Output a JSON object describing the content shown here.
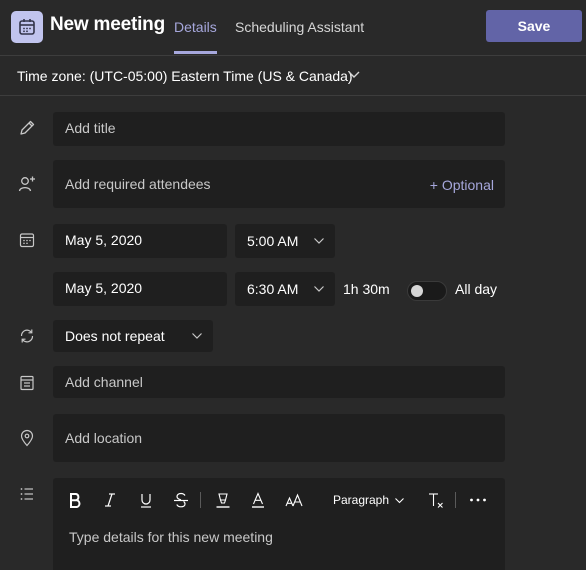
{
  "header": {
    "title": "New meeting",
    "tabs": [
      {
        "label": "Details",
        "active": true
      },
      {
        "label": "Scheduling Assistant",
        "active": false
      }
    ],
    "save_label": "Save"
  },
  "timezone": {
    "label": "Time zone: (UTC-05:00) Eastern Time (US & Canada)"
  },
  "form": {
    "title_placeholder": "Add title",
    "attendees_placeholder": "Add required attendees",
    "optional_label": "+ Optional",
    "start_date": "May 5, 2020",
    "start_time": "5:00 AM",
    "end_date": "May 5, 2020",
    "end_time": "6:30 AM",
    "duration": "1h 30m",
    "all_day_label": "All day",
    "all_day_on": false,
    "repeat_value": "Does not repeat",
    "channel_placeholder": "Add channel",
    "location_placeholder": "Add location"
  },
  "editor": {
    "paragraph_label": "Paragraph",
    "placeholder": "Type details for this new meeting",
    "toolbar_icons": [
      "bold-icon",
      "italic-icon",
      "underline-icon",
      "strikethrough-icon",
      "highlight-icon",
      "font-color-icon",
      "font-size-icon",
      "clear-formatting-icon",
      "more-options-icon"
    ]
  },
  "colors": {
    "accent": "#6264a7",
    "accent_text": "#a6a7dc",
    "background": "#292929",
    "field": "#1f1f1f"
  }
}
